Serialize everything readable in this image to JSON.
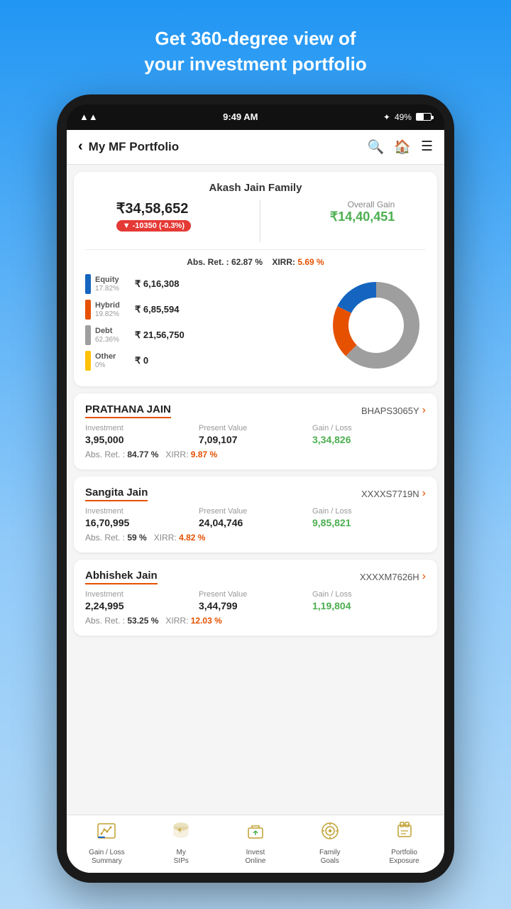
{
  "hero": {
    "line1": "Get 360-degree view of",
    "line2": "your investment portfolio"
  },
  "status_bar": {
    "time": "9:49 AM",
    "wifi": "WiFi",
    "bluetooth": "BT",
    "battery": "49%"
  },
  "header": {
    "back_label": "‹",
    "title": "My MF Portfolio",
    "search_icon": "🔍",
    "home_icon": "🏠",
    "menu_icon": "☰"
  },
  "portfolio": {
    "family_name": "Akash Jain Family",
    "total_value": "₹34,58,652",
    "change_badge": "▼ -10350 (-0.3%)",
    "overall_gain_label": "Overall Gain",
    "overall_gain_amount": "₹14,40,451",
    "abs_ret_label": "Abs. Ret. :",
    "abs_ret_value": "62.87 %",
    "xirr_label": "XIRR:",
    "xirr_value": "5.69 %",
    "categories": [
      {
        "name": "Equity",
        "pct": "17.82%",
        "amount": "₹ 6,16,308",
        "color": "#1565c0"
      },
      {
        "name": "Hybrid",
        "pct": "19.82%",
        "amount": "₹ 6,85,594",
        "color": "#e65100"
      },
      {
        "name": "Debt",
        "pct": "62.36%",
        "amount": "₹ 21,56,750",
        "color": "#9e9e9e"
      },
      {
        "name": "Other",
        "pct": "0%",
        "amount": "₹ 0",
        "color": "#ffc107"
      }
    ],
    "donut": {
      "equity_pct": 17.82,
      "hybrid_pct": 19.82,
      "debt_pct": 62.36,
      "other_pct": 0
    }
  },
  "members": [
    {
      "name": "PRATHANA JAIN",
      "id": "BHAPS3065Y",
      "investment": "3,95,000",
      "present_value": "7,09,107",
      "gain_loss": "3,34,826",
      "abs_ret": "84.77 %",
      "xirr": "9.87 %"
    },
    {
      "name": "Sangita Jain",
      "id": "XXXXS7719N",
      "investment": "16,70,995",
      "present_value": "24,04,746",
      "gain_loss": "9,85,821",
      "abs_ret": "59 %",
      "xirr": "4.82 %"
    },
    {
      "name": "Abhishek Jain",
      "id": "XXXXM7626H",
      "investment": "2,24,995",
      "present_value": "3,44,799",
      "gain_loss": "1,19,804",
      "abs_ret": "53.25 %",
      "xirr": "12.03 %"
    }
  ],
  "col_labels": {
    "investment": "Investment",
    "present_value": "Present Value",
    "gain_loss": "Gain / Loss"
  },
  "bottom_nav": [
    {
      "label": "Gain / Loss\nSummary",
      "icon": "📊"
    },
    {
      "label": "My\nSIPs",
      "icon": "💰"
    },
    {
      "label": "Invest\nOnline",
      "icon": "🛒"
    },
    {
      "label": "Family\nGoals",
      "icon": "🎯"
    },
    {
      "label": "Portfolio\nExposure",
      "icon": "📁"
    }
  ]
}
